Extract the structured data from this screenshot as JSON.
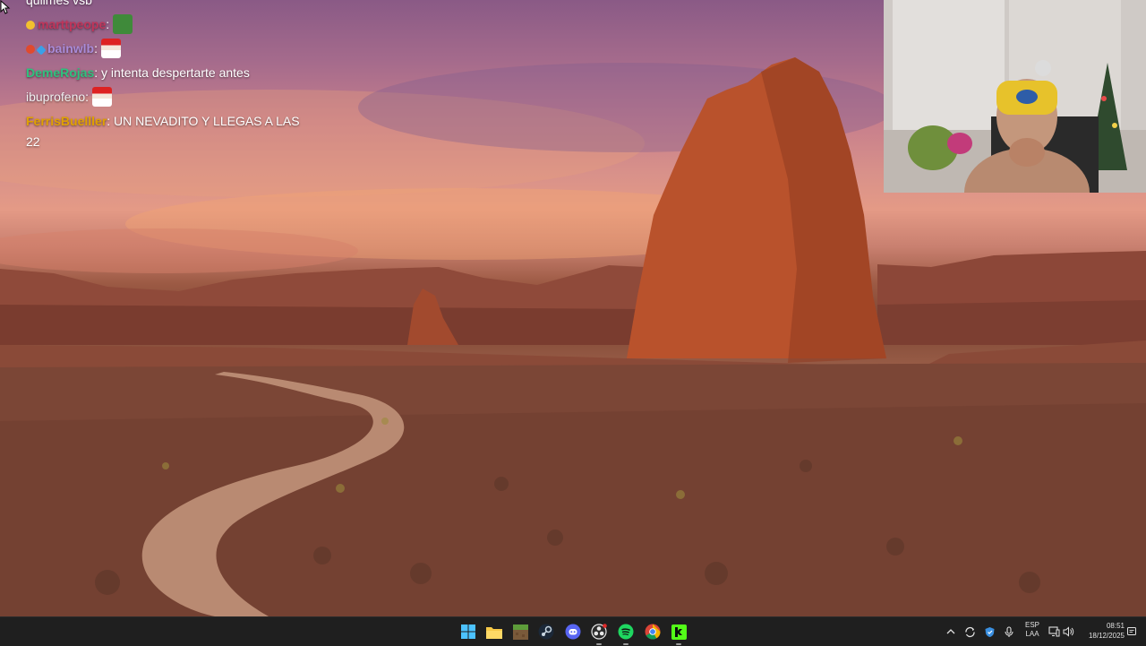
{
  "chat": {
    "messages": [
      {
        "user": "quilmes vsb",
        "color": "#ffffff",
        "text": "",
        "partial": true
      },
      {
        "user": "marttpeope",
        "color": "#c0355a",
        "text": ":",
        "emote": "green-emote"
      },
      {
        "user": "bainwlb",
        "color": "#a98bd8",
        "text": ":",
        "emote": "santa-emote"
      },
      {
        "user": "DemeRojas",
        "color": "#2ec27e",
        "text": ": y intenta despertarte antes"
      },
      {
        "user": "ibuprofeno",
        "color": "#f0f0f0",
        "text": ":",
        "emote": "santa-emote"
      },
      {
        "user": "FerrisBuelller",
        "color": "#e0a100",
        "text": ": UN NEVADITO Y LLEGAS A LAS 22"
      }
    ]
  },
  "taskbar": {
    "apps": [
      {
        "name": "start-icon"
      },
      {
        "name": "file-explorer-icon"
      },
      {
        "name": "minecraft-icon"
      },
      {
        "name": "steam-icon"
      },
      {
        "name": "discord-icon"
      },
      {
        "name": "obs-icon"
      },
      {
        "name": "spotify-icon"
      },
      {
        "name": "chrome-icon"
      },
      {
        "name": "kick-icon"
      }
    ],
    "tray": {
      "language_line1": "ESP",
      "language_line2": "LAA",
      "time": "08:51",
      "date": "18/12/2025"
    }
  },
  "colors": {
    "taskbar_bg": "#1f1f1f",
    "spotify": "#1ed760",
    "kick": "#53fc18"
  }
}
